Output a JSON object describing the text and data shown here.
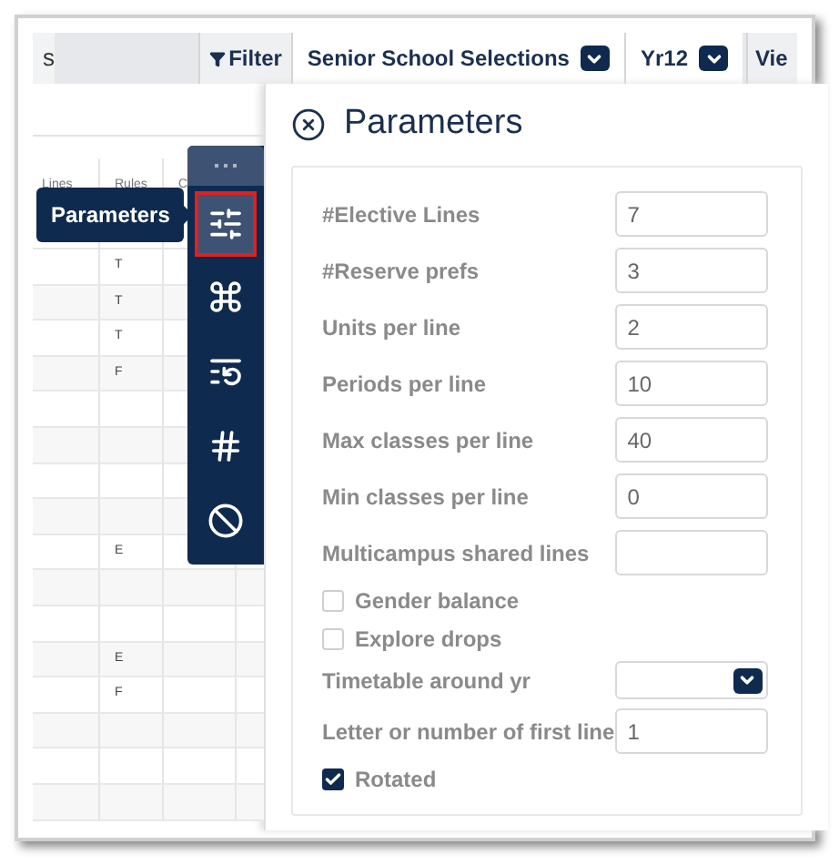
{
  "top_bar": {
    "tab": "s",
    "filter_button": "Filter",
    "selects": [
      {
        "value": "Senior School Selections"
      },
      {
        "value": "Yr12"
      }
    ],
    "view_button": "Vie"
  },
  "table": {
    "columns": [
      "Lines",
      "Rules",
      "C"
    ],
    "rows": [
      {
        "rules": "T"
      },
      {
        "rules": "T"
      },
      {
        "rules": "T"
      },
      {
        "rules": "F"
      },
      {},
      {},
      {},
      {},
      {
        "rules": "E"
      },
      {},
      {},
      {
        "rules": "E"
      },
      {
        "rules": "F"
      },
      {},
      {},
      {}
    ]
  },
  "tooltip": "Parameters",
  "toolbar": {
    "items": [
      {
        "kind": "sliders",
        "selected": true
      },
      {
        "kind": "command",
        "selected": false
      },
      {
        "kind": "sort",
        "selected": false
      },
      {
        "kind": "hash",
        "selected": false
      },
      {
        "kind": "ban",
        "selected": false
      }
    ]
  },
  "panel": {
    "title": "Parameters",
    "fields": [
      {
        "kind": "input",
        "label": "#Elective Lines",
        "value": "7"
      },
      {
        "kind": "input",
        "label": "#Reserve prefs",
        "value": "3"
      },
      {
        "kind": "input",
        "label": "Units per line",
        "value": "2"
      },
      {
        "kind": "input",
        "label": "Periods per line",
        "value": "10"
      },
      {
        "kind": "input",
        "label": "Max classes per line",
        "value": "40"
      },
      {
        "kind": "input",
        "label": "Min classes per line",
        "value": "0"
      },
      {
        "kind": "input",
        "label": "Multicampus shared lines"
      },
      {
        "kind": "checkbox",
        "label": "Gender balance",
        "checked": false
      },
      {
        "kind": "checkbox",
        "label": "Explore drops",
        "checked": false
      },
      {
        "kind": "select",
        "label": "Timetable around yr"
      },
      {
        "kind": "input",
        "label": "Letter or number of first line",
        "value": "1"
      },
      {
        "kind": "checkbox",
        "label": "Rotated",
        "checked": true
      }
    ]
  }
}
